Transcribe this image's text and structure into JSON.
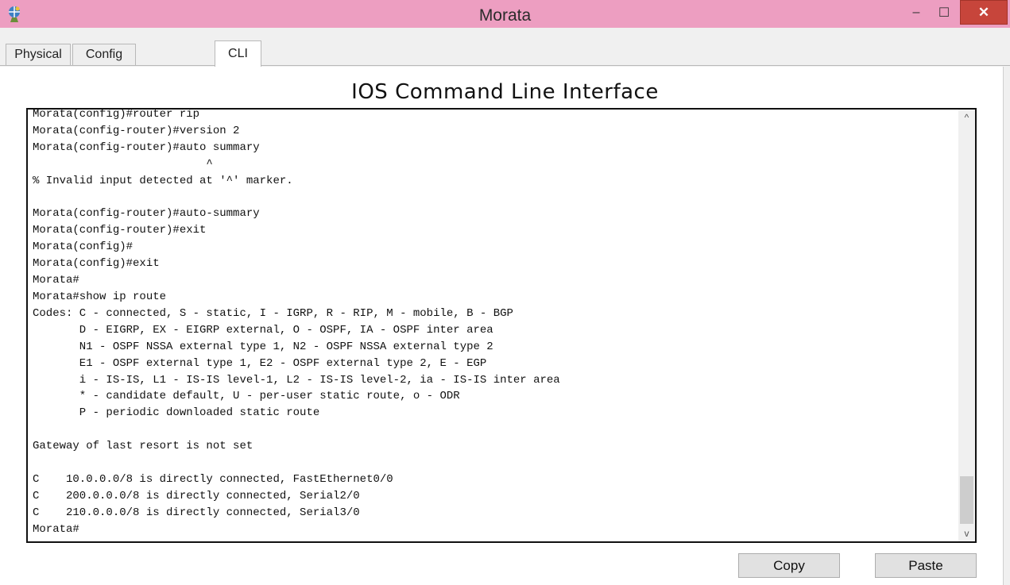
{
  "window": {
    "title": "Morata",
    "icon": "router-app-icon",
    "controls": {
      "minimize": "–",
      "maximize": "☐",
      "close": "✕"
    },
    "accent_color": "#ed9ec1",
    "close_color": "#c7453b"
  },
  "tabs": [
    {
      "label": "Physical",
      "active": false
    },
    {
      "label": "Config",
      "active": false
    },
    {
      "label": "CLI",
      "active": true
    }
  ],
  "cli": {
    "heading": "IOS Command Line Interface",
    "output": "Morata(config)#router rip\nMorata(config-router)#version 2\nMorata(config-router)#auto summary\n                          ^\n% Invalid input detected at '^' marker.\n\nMorata(config-router)#auto-summary\nMorata(config-router)#exit\nMorata(config)#\nMorata(config)#exit\nMorata#\nMorata#show ip route\nCodes: C - connected, S - static, I - IGRP, R - RIP, M - mobile, B - BGP\n       D - EIGRP, EX - EIGRP external, O - OSPF, IA - OSPF inter area\n       N1 - OSPF NSSA external type 1, N2 - OSPF NSSA external type 2\n       E1 - OSPF external type 1, E2 - OSPF external type 2, E - EGP\n       i - IS-IS, L1 - IS-IS level-1, L2 - IS-IS level-2, ia - IS-IS inter area\n       * - candidate default, U - per-user static route, o - ODR\n       P - periodic downloaded static route\n\nGateway of last resort is not set\n\nC    10.0.0.0/8 is directly connected, FastEthernet0/0\nC    200.0.0.0/8 is directly connected, Serial2/0\nC    210.0.0.0/8 is directly connected, Serial3/0\nMorata#"
  },
  "scrollbar": {
    "up": "^",
    "down": "v",
    "position": 0.92
  },
  "buttons": {
    "copy": "Copy",
    "paste": "Paste"
  }
}
